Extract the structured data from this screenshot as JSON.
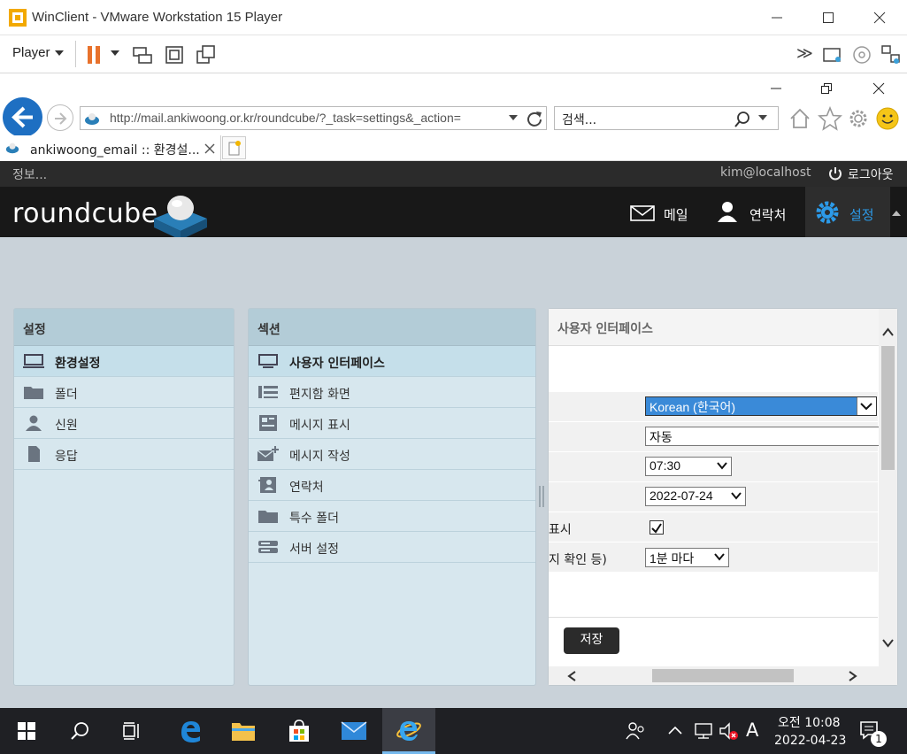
{
  "vm": {
    "title": "WinClient - VMware Workstation 15 Player",
    "player_label": "Player"
  },
  "ie": {
    "url": "http://mail.ankiwoong.or.kr/roundcube/?_task=settings&_action=",
    "search_placeholder": "검색...",
    "tab_label": "ankiwoong_email :: 환경설..."
  },
  "rc": {
    "info_label": "정보...",
    "user": "kim@localhost",
    "logout": "로그아웃",
    "logo_text": "roundcube",
    "nav": [
      {
        "label": "메일",
        "icon": "mail-icon"
      },
      {
        "label": "연락처",
        "icon": "contacts-icon"
      },
      {
        "label": "설정",
        "icon": "gear-icon"
      }
    ],
    "settings_panel": {
      "title": "설정",
      "items": [
        {
          "label": "환경설정",
          "icon": "monitor-icon"
        },
        {
          "label": "폴더",
          "icon": "folder-icon"
        },
        {
          "label": "신원",
          "icon": "person-icon"
        },
        {
          "label": "응답",
          "icon": "document-icon"
        }
      ]
    },
    "section_panel": {
      "title": "섹션",
      "items": [
        {
          "label": "사용자 인터페이스",
          "icon": "monitor-icon"
        },
        {
          "label": "편지함 화면",
          "icon": "mailbox-list-icon"
        },
        {
          "label": "메시지 표시",
          "icon": "message-view-icon"
        },
        {
          "label": "메시지 작성",
          "icon": "compose-icon"
        },
        {
          "label": "연락처",
          "icon": "addressbook-icon"
        },
        {
          "label": "특수 폴더",
          "icon": "folder-icon"
        },
        {
          "label": "서버 설정",
          "icon": "server-icon"
        }
      ]
    },
    "ui_panel": {
      "title": "사용자 인터페이스",
      "language": "Korean (한국어)",
      "timezone": "자동",
      "time_format": "07:30",
      "date_format": "2022-07-24",
      "show_label": "표시",
      "refresh_label": "지 확인 등)",
      "refresh_value": "1분 마다",
      "save_label": "저장"
    }
  },
  "taskbar": {
    "time": "오전 10:08",
    "date": "2022-04-23",
    "ime": "A",
    "notification_count": "1"
  }
}
